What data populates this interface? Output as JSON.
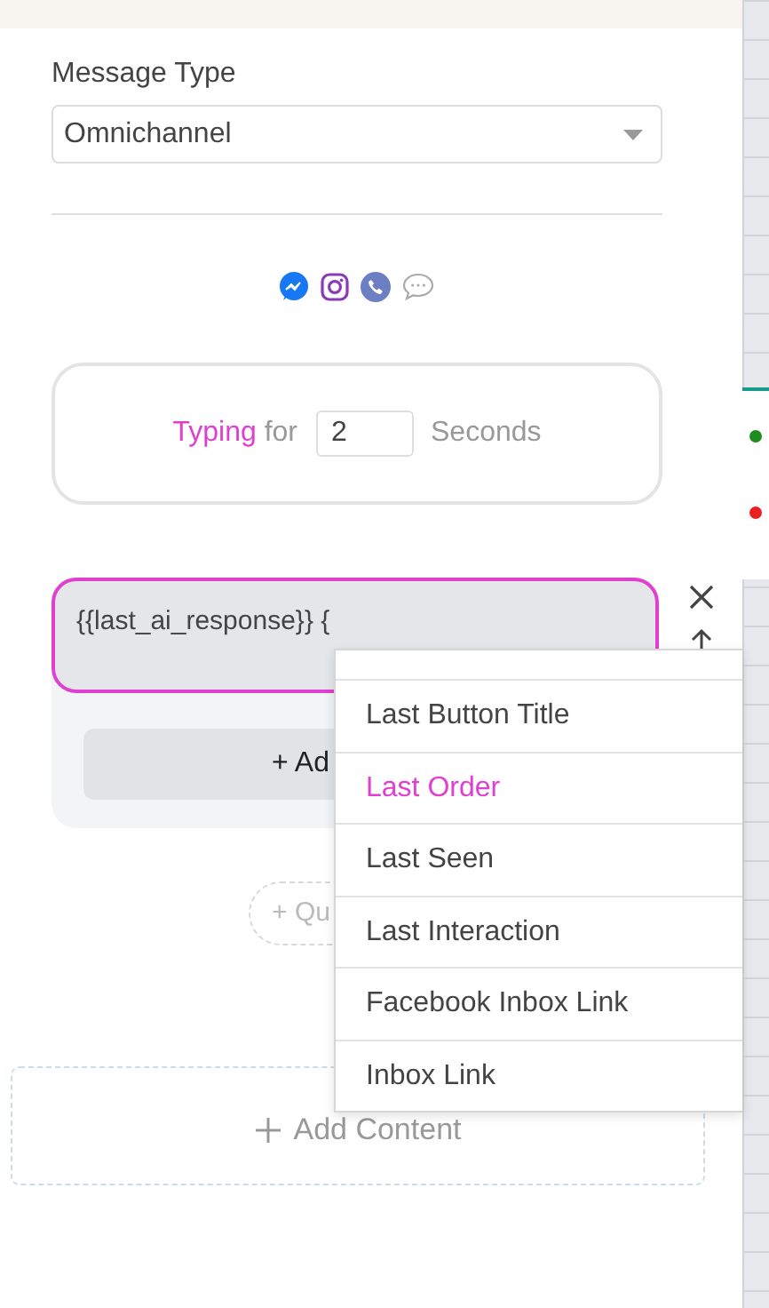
{
  "message_type": {
    "label": "Message Type",
    "value": "Omnichannel"
  },
  "typing": {
    "word": "Typing",
    "for": "for",
    "seconds": "2",
    "unit": "Seconds"
  },
  "editor": {
    "text": "{{last_ai_response}} {",
    "add_button": "+ Ad"
  },
  "quick_reply": "+ Qu",
  "add_content": "Add Content",
  "canvas_node": {
    "ports": [
      {
        "color": "#1e8c1e"
      },
      {
        "color": "#e82020"
      }
    ]
  },
  "variable_menu": [
    {
      "label": "Last Button Title",
      "selected": false
    },
    {
      "label": "Last Order",
      "selected": true
    },
    {
      "label": "Last Seen",
      "selected": false
    },
    {
      "label": "Last Interaction",
      "selected": false
    },
    {
      "label": "Facebook Inbox Link",
      "selected": false
    },
    {
      "label": "Inbox Link",
      "selected": false
    }
  ]
}
